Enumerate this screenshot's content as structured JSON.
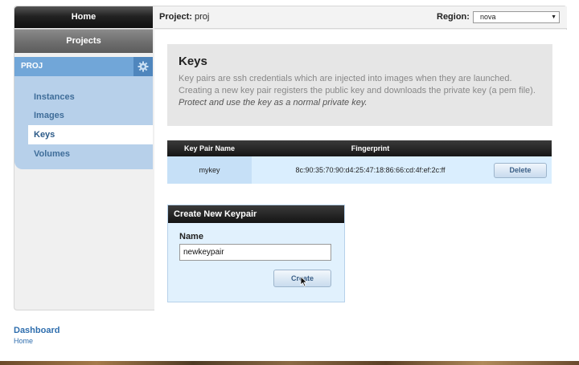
{
  "sidebar": {
    "home_label": "Home",
    "projects_label": "Projects",
    "project_name": "PROJ",
    "items": [
      {
        "label": "Instances"
      },
      {
        "label": "Images"
      },
      {
        "label": "Keys",
        "active": true
      },
      {
        "label": "Volumes"
      }
    ]
  },
  "topbar": {
    "project_label": "Project:",
    "project_value": "proj",
    "region_label": "Region:",
    "region_value": "nova"
  },
  "info": {
    "title": "Keys",
    "line1": "Key pairs are ssh credentials which are injected into images when they are launched.",
    "line2": "Creating a new key pair registers the public key and downloads the private key (a pem file).",
    "line3": "Protect and use the key as a normal private key."
  },
  "table": {
    "headers": [
      "Key Pair Name",
      "Fingerprint",
      ""
    ],
    "rows": [
      {
        "name": "mykey",
        "fingerprint": "8c:90:35:70:90:d4:25:47:18:86:66:cd:4f:ef:2c:ff",
        "action": "Delete"
      }
    ]
  },
  "create": {
    "title": "Create New Keypair",
    "name_label": "Name",
    "name_value": "newkeypair",
    "button_label": "Create"
  },
  "footer": {
    "title": "Dashboard",
    "link": "Home"
  },
  "icons": {
    "settings": "gear-icon",
    "dropdown": "chevron-down-icon",
    "cursor": "mouse-pointer-icon"
  },
  "colors": {
    "accent": "#71a6d8",
    "link": "#2f6eae"
  }
}
